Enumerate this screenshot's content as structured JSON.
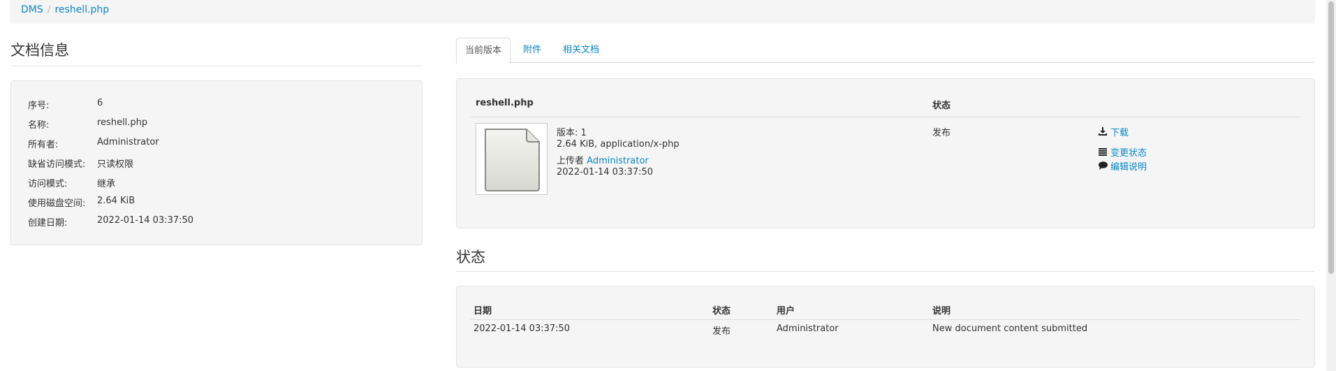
{
  "breadcrumb": {
    "root": "DMS",
    "separator": "/",
    "current": "reshell.php"
  },
  "doc_info": {
    "title": "文档信息",
    "rows": [
      {
        "label": "序号:",
        "value": "6"
      },
      {
        "label": "名称:",
        "value": "reshell.php"
      },
      {
        "label": "所有者:",
        "value": "Administrator"
      },
      {
        "label": "缺省访问模式:",
        "value": "只读权限"
      },
      {
        "label": "访问模式:",
        "value": "继承"
      },
      {
        "label": "使用磁盘空间:",
        "value": "2.64 KiB"
      },
      {
        "label": "创建日期:",
        "value": "2022-01-14 03:37:50"
      }
    ]
  },
  "tabs": [
    "当前版本",
    "附件",
    "相关文档"
  ],
  "version": {
    "filename": "reshell.php",
    "status_header": "状态",
    "version_line": "版本: 1",
    "size_line": "2.64 KiB, application/x-php",
    "uploader_label": "上传者",
    "uploader": "Administrator",
    "date": "2022-01-14 03:37:50",
    "status": "发布",
    "actions": [
      "下载",
      "变更状态",
      "编辑说明"
    ]
  },
  "status_section": {
    "title": "状态",
    "headers": [
      "日期",
      "状态",
      "用户",
      "说明"
    ],
    "rows": [
      [
        "2022-01-14 03:37:50",
        "发布",
        "Administrator",
        "New document content submitted"
      ]
    ]
  }
}
